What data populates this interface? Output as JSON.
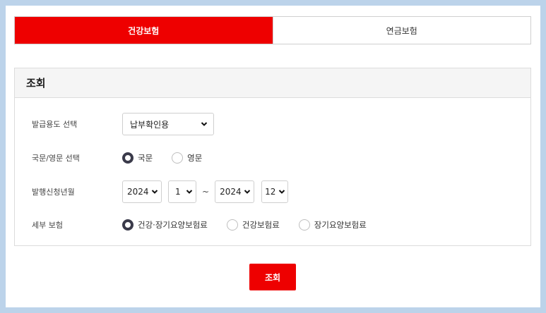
{
  "tabs": [
    {
      "label": "건강보험",
      "active": true
    },
    {
      "label": "연금보험",
      "active": false
    }
  ],
  "panel": {
    "title": "조회"
  },
  "form": {
    "purpose": {
      "label": "발급용도 선택",
      "selected": "납부확인용"
    },
    "language": {
      "label": "국문/영문 선택",
      "options": [
        {
          "label": "국문",
          "checked": true
        },
        {
          "label": "영문",
          "checked": false
        }
      ]
    },
    "period": {
      "label": "발행신청년월",
      "from_year": "2024",
      "from_month": "1",
      "separator": "~",
      "to_year": "2024",
      "to_month": "12"
    },
    "detail": {
      "label": "세부 보험",
      "options": [
        {
          "label": "건강·장기요양보험료",
          "checked": true
        },
        {
          "label": "건강보험료",
          "checked": false
        },
        {
          "label": "장기요양보험료",
          "checked": false
        }
      ]
    }
  },
  "submit_label": "조회",
  "colors": {
    "accent": "#ee0000",
    "frame": "#bcd3ea",
    "panel_head": "#f5f5f5"
  }
}
